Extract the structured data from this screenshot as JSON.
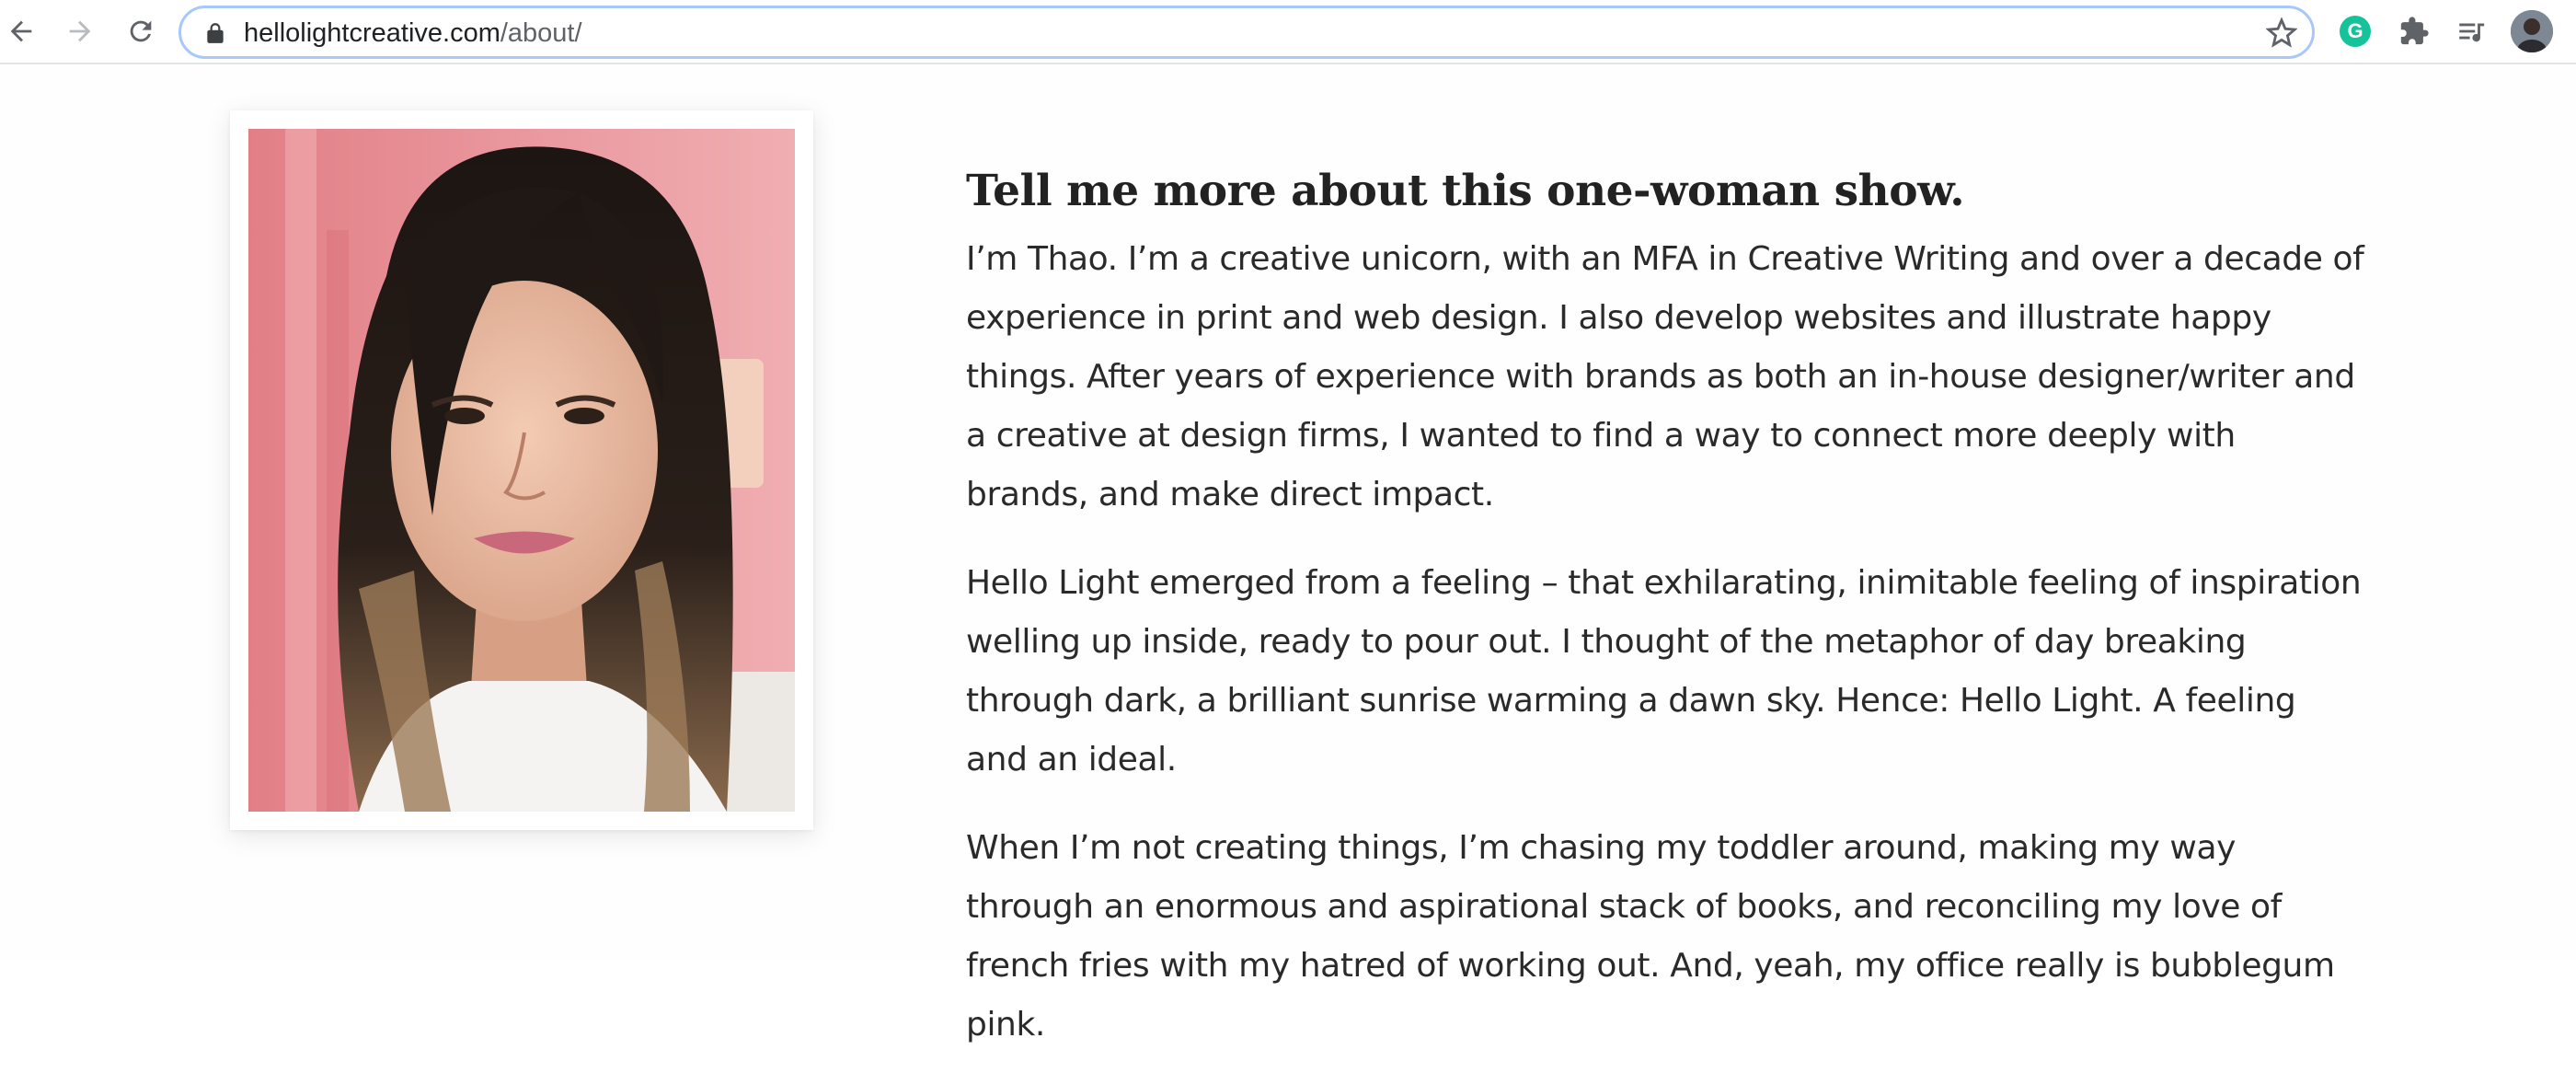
{
  "browser": {
    "url_host": "hellolightcreative.com",
    "url_path": "/about/",
    "icons": [
      "back-arrow-icon",
      "forward-arrow-icon",
      "reload-icon",
      "lock-icon",
      "bookmark-star-icon",
      "grammarly-icon",
      "extensions-puzzle-icon",
      "media-queue-icon",
      "profile-avatar"
    ],
    "grammarly_letter": "G",
    "accent_color": "#a8c7fa",
    "grammarly_color": "#15c39a"
  },
  "about": {
    "heading": "Tell me more about this one-woman show.",
    "paragraphs": [
      "I’m Thao.  I’m a creative unicorn, with an  MFA in Creative Writing and over a decade of experience in print and web design.  I also develop websites and illustrate happy things.  After years of experience with brands as both an in-house designer/writer and a creative at design firms,  I wanted to find a way to connect more deeply with brands, and make direct impact.",
      "Hello  Light emerged from a feeling – that exhilarating, inimitable feeling of inspiration welling up inside, ready to pour out.  I thought of the metaphor of day breaking through dark, a brilliant sunrise warming a dawn sky.  Hence:  Hello  Light. A feeling and an ideal.",
      "When  I’m not creating things,  I’m chasing my toddler around, making my way through an enormous and aspirational stack of books, and reconciling my love of french fries with my hatred of working out. And, yeah, my office really is bubblegum pink."
    ],
    "photo_background_color": "#e98a8f"
  }
}
